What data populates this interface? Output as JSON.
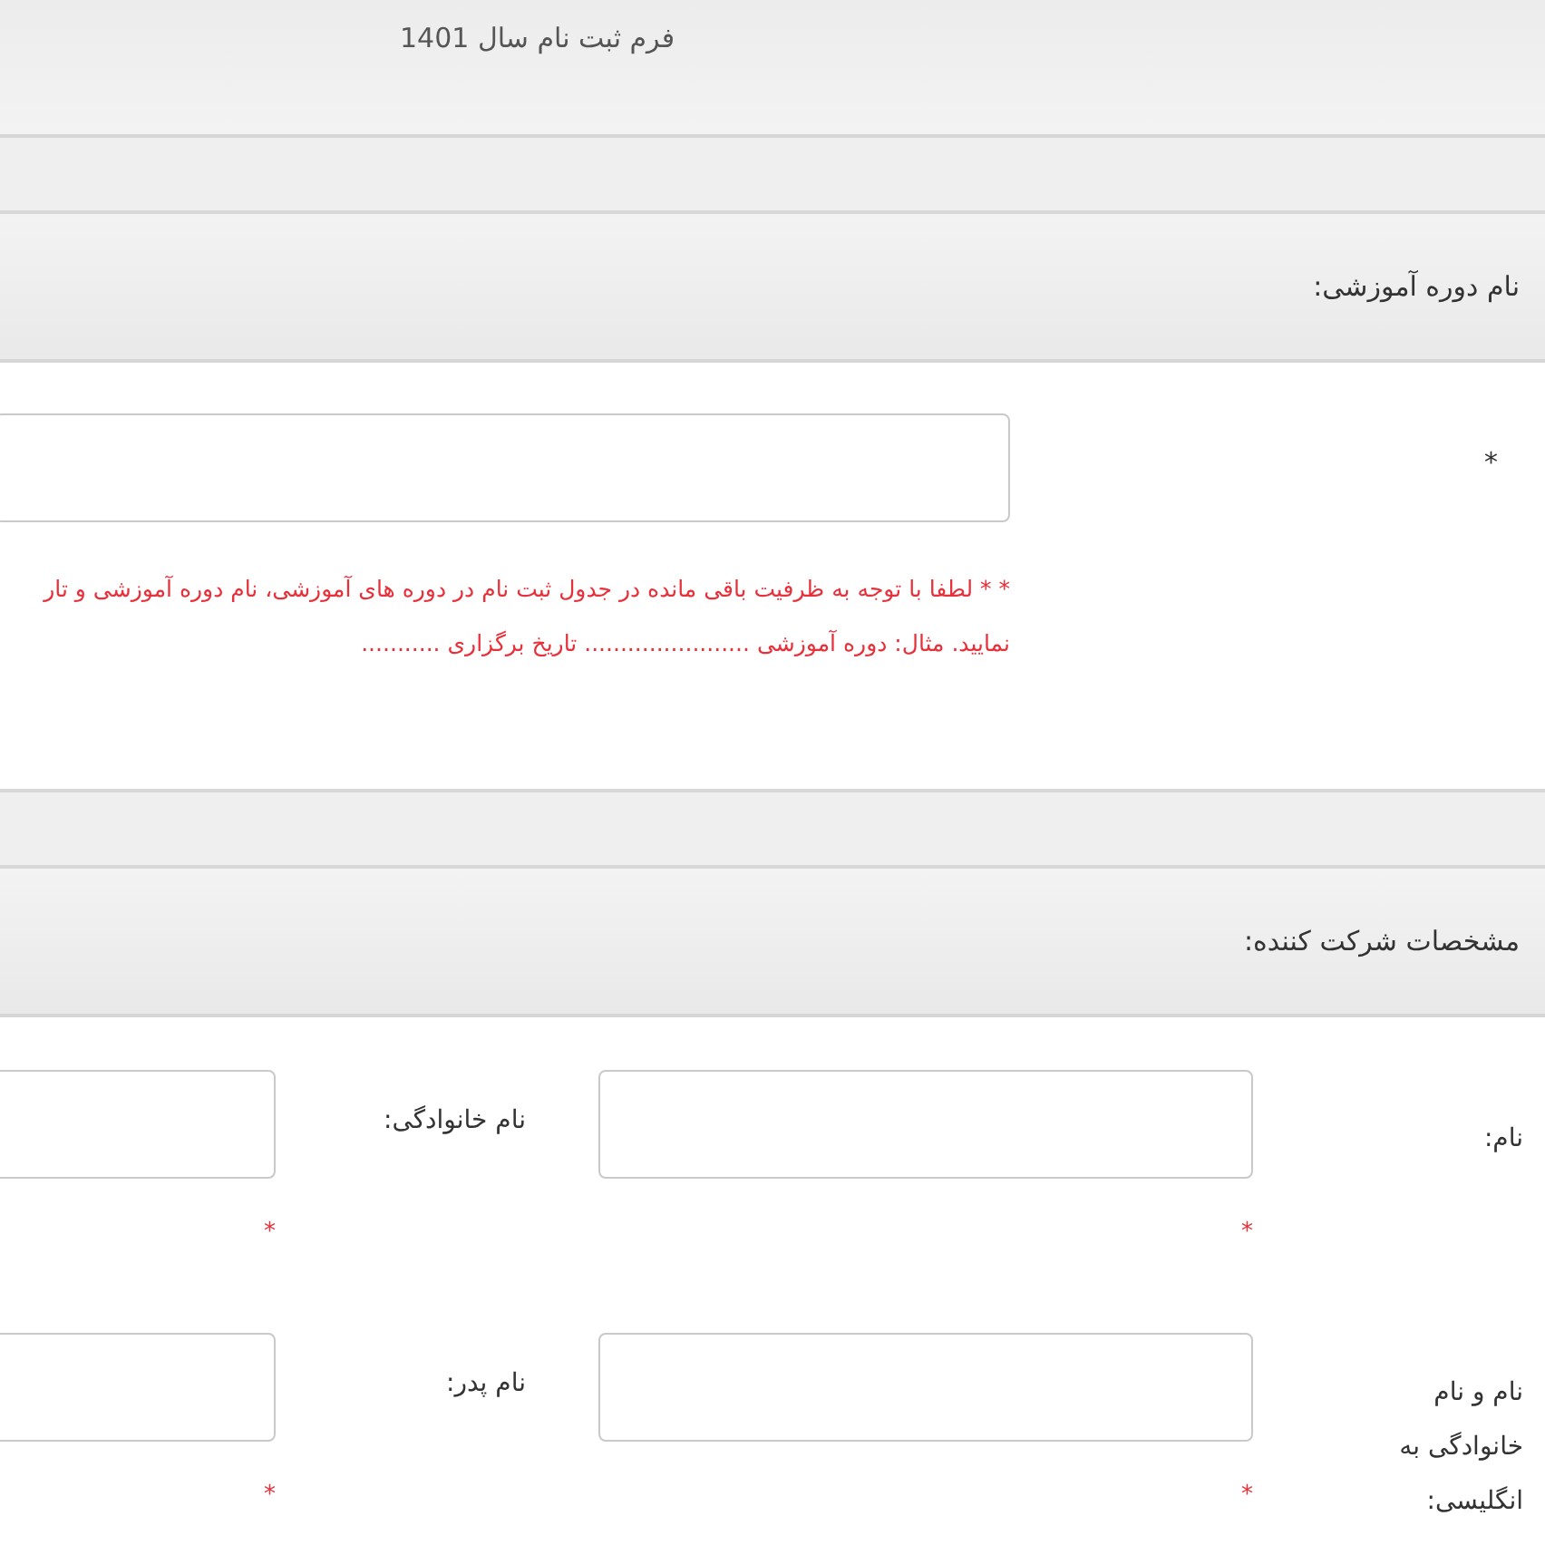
{
  "page_title": "فرم ثبت نام سال 1401",
  "sections": [
    {
      "heading": "نام دوره آموزشی:",
      "kind": "course",
      "label": "*",
      "note_lines": [
        "* * لطفا با توجه به ظرفیت باقی مانده در جدول ثبت نام در دوره های آموزشی، نام دوره آموزشی و تار",
        "نمایید. مثال: دوره آموزشی ....................... تاریخ برگزاری ..........."
      ]
    },
    {
      "heading": "مشخصات شرکت کننده:",
      "kind": "fields",
      "rows": [
        [
          {
            "label": "نام:",
            "required_mark": "*"
          },
          {
            "label": "نام خانوادگی:",
            "required_mark": "*"
          }
        ],
        [
          {
            "label": "نام و نام خانوادگی به انگلیسی:",
            "required_mark": "*"
          },
          {
            "label": "نام پدر:",
            "required_mark": "*"
          }
        ]
      ]
    }
  ]
}
